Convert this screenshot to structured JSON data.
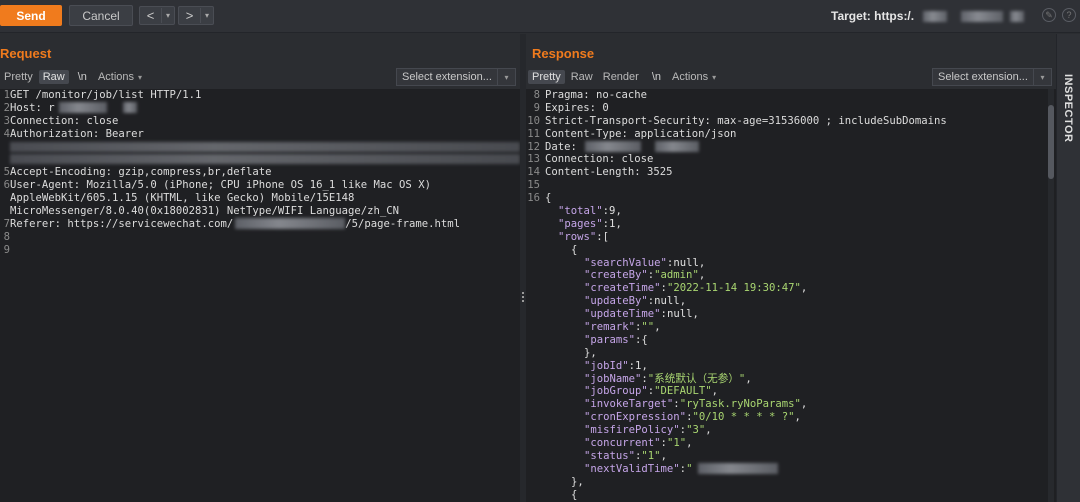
{
  "toolbar": {
    "send_label": "Send",
    "cancel_label": "Cancel",
    "back_glyph": "<",
    "forward_glyph": ">",
    "dropdown_glyph": "▾",
    "target_label": "Target: https:/."
  },
  "request": {
    "title": "Request",
    "tabs": {
      "pretty": "Pretty",
      "raw": "Raw",
      "newline": "\\n",
      "actions": "Actions"
    },
    "select_extension": "Select extension...",
    "lines": [
      {
        "n": "1",
        "t": "GET /monitor/job/list HTTP/1.1"
      },
      {
        "n": "2",
        "t": "Host: r"
      },
      {
        "n": "3",
        "t": "Connection: close"
      },
      {
        "n": "4",
        "t": "Authorization: Bearer"
      },
      {
        "n": "",
        "t": ""
      },
      {
        "n": "",
        "t": ""
      },
      {
        "n": "5",
        "t": "Accept-Encoding: gzip,compress,br,deflate"
      },
      {
        "n": "6",
        "t": "User-Agent: Mozilla/5.0 (iPhone; CPU iPhone OS 16_1 like Mac OS X)"
      },
      {
        "n": "",
        "t": "AppleWebKit/605.1.15 (KHTML, like Gecko) Mobile/15E148"
      },
      {
        "n": "",
        "t": "MicroMessenger/8.0.40(0x18002831) NetType/WIFI Language/zh_CN"
      },
      {
        "n": "7",
        "t": "Referer: https://servicewechat.com/"
      },
      {
        "n": "8",
        "t": ""
      },
      {
        "n": "9",
        "t": ""
      }
    ],
    "referer_suffix": "/5/page-frame.html"
  },
  "response": {
    "title": "Response",
    "tabs": {
      "pretty": "Pretty",
      "raw": "Raw",
      "render": "Render",
      "newline": "\\n",
      "actions": "Actions"
    },
    "select_extension": "Select extension...",
    "headers": [
      {
        "n": "8",
        "t": "Pragma: no-cache"
      },
      {
        "n": "9",
        "t": "Expires: 0"
      },
      {
        "n": "10",
        "t": "Strict-Transport-Security: max-age=31536000 ; includeSubDomains"
      },
      {
        "n": "11",
        "t": "Content-Type: application/json"
      },
      {
        "n": "12",
        "t": "Date:"
      },
      {
        "n": "13",
        "t": "Connection: close"
      },
      {
        "n": "14",
        "t": "Content-Length: 3525"
      },
      {
        "n": "15",
        "t": ""
      },
      {
        "n": "16",
        "t": "{"
      }
    ],
    "json": [
      {
        "indent": 1,
        "key": "\"total\"",
        "val": "9",
        "vt": "n",
        "end": ","
      },
      {
        "indent": 1,
        "key": "\"pages\"",
        "val": "1",
        "vt": "n",
        "end": ","
      },
      {
        "indent": 1,
        "key": "\"rows\"",
        "val": "[",
        "vt": "p",
        "end": ""
      },
      {
        "indent": 2,
        "key": "",
        "val": "{",
        "vt": "p",
        "end": ""
      },
      {
        "indent": 3,
        "key": "\"searchValue\"",
        "val": "null",
        "vt": "n",
        "end": ","
      },
      {
        "indent": 3,
        "key": "\"createBy\"",
        "val": "\"admin\"",
        "vt": "s",
        "end": ","
      },
      {
        "indent": 3,
        "key": "\"createTime\"",
        "val": "\"2022-11-14 19:30:47\"",
        "vt": "s",
        "end": ","
      },
      {
        "indent": 3,
        "key": "\"updateBy\"",
        "val": "null",
        "vt": "n",
        "end": ","
      },
      {
        "indent": 3,
        "key": "\"updateTime\"",
        "val": "null",
        "vt": "n",
        "end": ","
      },
      {
        "indent": 3,
        "key": "\"remark\"",
        "val": "\"\"",
        "vt": "s",
        "end": ","
      },
      {
        "indent": 3,
        "key": "\"params\"",
        "val": "{",
        "vt": "p",
        "end": ""
      },
      {
        "indent": 3,
        "key": "",
        "val": "},",
        "vt": "p",
        "end": ""
      },
      {
        "indent": 3,
        "key": "\"jobId\"",
        "val": "1",
        "vt": "n",
        "end": ","
      },
      {
        "indent": 3,
        "key": "\"jobName\"",
        "val": "\"系统默认（无参）\"",
        "vt": "s",
        "end": ","
      },
      {
        "indent": 3,
        "key": "\"jobGroup\"",
        "val": "\"DEFAULT\"",
        "vt": "s",
        "end": ","
      },
      {
        "indent": 3,
        "key": "\"invokeTarget\"",
        "val": "\"ryTask.ryNoParams\"",
        "vt": "s",
        "end": ","
      },
      {
        "indent": 3,
        "key": "\"cronExpression\"",
        "val": "\"0/10 * * * * ?\"",
        "vt": "s",
        "end": ","
      },
      {
        "indent": 3,
        "key": "\"misfirePolicy\"",
        "val": "\"3\"",
        "vt": "s",
        "end": ","
      },
      {
        "indent": 3,
        "key": "\"concurrent\"",
        "val": "\"1\"",
        "vt": "s",
        "end": ","
      },
      {
        "indent": 3,
        "key": "\"status\"",
        "val": "\"1\"",
        "vt": "s",
        "end": ","
      },
      {
        "indent": 3,
        "key": "\"nextValidTime\"",
        "val": "\"",
        "vt": "s",
        "end": ""
      },
      {
        "indent": 2,
        "key": "",
        "val": "},",
        "vt": "p",
        "end": ""
      },
      {
        "indent": 2,
        "key": "",
        "val": "{",
        "vt": "p",
        "end": ""
      }
    ]
  },
  "inspector": {
    "label": "INSPECTOR"
  },
  "colors": {
    "accent": "#f07b1d",
    "json_key": "#c5a5e8",
    "json_string": "#a9d671"
  }
}
